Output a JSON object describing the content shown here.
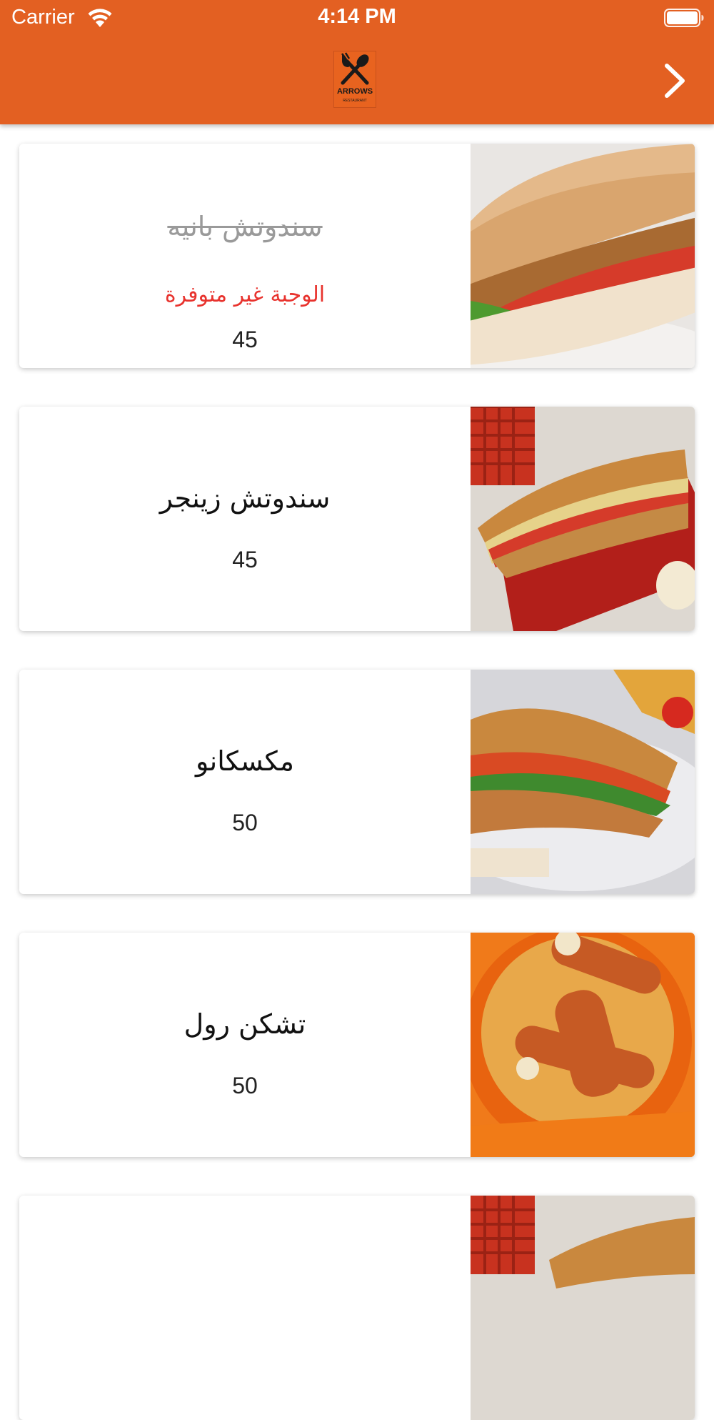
{
  "status_bar": {
    "carrier": "Carrier",
    "time": "4:14 PM"
  },
  "header": {
    "logo_text": "ARROWS",
    "logo_subtext": "RESTAURANT",
    "next_icon": "chevron-right-icon",
    "background_color": "#E36022"
  },
  "menu_items": [
    {
      "name": "سندوتش بانيه",
      "status": "الوجبة غير متوفرة",
      "price": "45",
      "available": false
    },
    {
      "name": "سندوتش زينجر",
      "price": "45",
      "available": true
    },
    {
      "name": "مكسكانو",
      "price": "50",
      "available": true
    },
    {
      "name": "تشكن رول",
      "price": "50",
      "available": true
    },
    {
      "name": "",
      "price": "",
      "available": true
    }
  ],
  "colors": {
    "unavailable_text": "#E8332E",
    "strikethrough_name": "#9a9a9a"
  }
}
